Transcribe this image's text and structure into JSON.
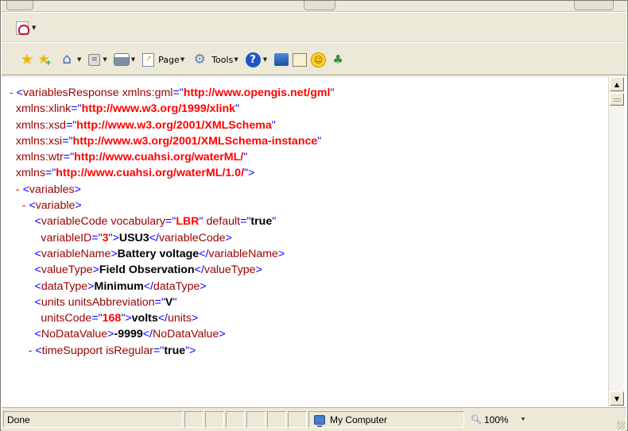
{
  "toolbar": {
    "page_label": "Page",
    "tools_label": "Tools"
  },
  "xml": {
    "lines": [
      [
        [
          "m",
          "- "
        ],
        [
          "b",
          "<"
        ],
        [
          "t",
          "variablesResponse "
        ],
        [
          "an",
          "xmlns:gml"
        ],
        [
          "b",
          "=\""
        ],
        [
          "av",
          "http://www.opengis.net/gml"
        ],
        [
          "b",
          "\""
        ]
      ],
      [
        [
          "an",
          "  xmlns:xlink"
        ],
        [
          "b",
          "=\""
        ],
        [
          "av",
          "http://www.w3.org/1999/xlink"
        ],
        [
          "b",
          "\""
        ]
      ],
      [
        [
          "an",
          "  xmlns:xsd"
        ],
        [
          "b",
          "=\""
        ],
        [
          "av",
          "http://www.w3.org/2001/XMLSchema"
        ],
        [
          "b",
          "\""
        ]
      ],
      [
        [
          "an",
          "  xmlns:xsi"
        ],
        [
          "b",
          "=\""
        ],
        [
          "av",
          "http://www.w3.org/2001/XMLSchema-instance"
        ],
        [
          "b",
          "\""
        ]
      ],
      [
        [
          "an",
          "  xmlns:wtr"
        ],
        [
          "b",
          "=\""
        ],
        [
          "av",
          "http://www.cuahsi.org/waterML/"
        ],
        [
          "b",
          "\""
        ]
      ],
      [
        [
          "an",
          "  xmlns"
        ],
        [
          "b",
          "=\""
        ],
        [
          "av",
          "http://www.cuahsi.org/waterML/1.0/"
        ],
        [
          "b",
          "\">"
        ]
      ],
      [
        [
          "m",
          "  - "
        ],
        [
          "b",
          "<"
        ],
        [
          "t",
          "variables"
        ],
        [
          "b",
          ">"
        ]
      ],
      [
        [
          "m",
          "    - "
        ],
        [
          "b",
          "<"
        ],
        [
          "t",
          "variable"
        ],
        [
          "b",
          ">"
        ]
      ],
      [
        [
          "b",
          "        <"
        ],
        [
          "t",
          "variableCode "
        ],
        [
          "an",
          "vocabulary"
        ],
        [
          "b",
          "=\""
        ],
        [
          "av",
          "LBR"
        ],
        [
          "b",
          "\" "
        ],
        [
          "an",
          "default"
        ],
        [
          "b",
          "=\""
        ],
        [
          "tx",
          "true"
        ],
        [
          "b",
          "\""
        ]
      ],
      [
        [
          "an",
          "          variableID"
        ],
        [
          "b",
          "=\""
        ],
        [
          "av",
          "3"
        ],
        [
          "b",
          "\">"
        ],
        [
          "tx",
          "USU3"
        ],
        [
          "b",
          "</"
        ],
        [
          "t",
          "variableCode"
        ],
        [
          "b",
          ">"
        ]
      ],
      [
        [
          "b",
          "        <"
        ],
        [
          "t",
          "variableName"
        ],
        [
          "b",
          ">"
        ],
        [
          "tx",
          "Battery voltage"
        ],
        [
          "b",
          "</"
        ],
        [
          "t",
          "variableName"
        ],
        [
          "b",
          ">"
        ]
      ],
      [
        [
          "b",
          "        <"
        ],
        [
          "t",
          "valueType"
        ],
        [
          "b",
          ">"
        ],
        [
          "tx",
          "Field Observation"
        ],
        [
          "b",
          "</"
        ],
        [
          "t",
          "valueType"
        ],
        [
          "b",
          ">"
        ]
      ],
      [
        [
          "b",
          "        <"
        ],
        [
          "t",
          "dataType"
        ],
        [
          "b",
          ">"
        ],
        [
          "tx",
          "Minimum"
        ],
        [
          "b",
          "</"
        ],
        [
          "t",
          "dataType"
        ],
        [
          "b",
          ">"
        ]
      ],
      [
        [
          "b",
          "        <"
        ],
        [
          "t",
          "units "
        ],
        [
          "an",
          "unitsAbbreviation"
        ],
        [
          "b",
          "=\""
        ],
        [
          "tx",
          "V"
        ],
        [
          "b",
          "\""
        ]
      ],
      [
        [
          "an",
          "          unitsCode"
        ],
        [
          "b",
          "=\""
        ],
        [
          "av",
          "168"
        ],
        [
          "b",
          "\">"
        ],
        [
          "tx",
          "volts"
        ],
        [
          "b",
          "</"
        ],
        [
          "t",
          "units"
        ],
        [
          "b",
          ">"
        ]
      ],
      [
        [
          "b",
          "        <"
        ],
        [
          "t",
          "NoDataValue"
        ],
        [
          "b",
          ">"
        ],
        [
          "tx",
          "-9999"
        ],
        [
          "b",
          "</"
        ],
        [
          "t",
          "NoDataValue"
        ],
        [
          "b",
          ">"
        ]
      ],
      [
        [
          "m",
          "      - "
        ],
        [
          "b",
          "<"
        ],
        [
          "t",
          "timeSupport "
        ],
        [
          "an",
          "isRegular"
        ],
        [
          "b",
          "=\""
        ],
        [
          "tx",
          "true"
        ],
        [
          "b",
          "\">"
        ]
      ]
    ]
  },
  "status": {
    "text": "Done",
    "zone": "My Computer",
    "zoom": "100%"
  }
}
